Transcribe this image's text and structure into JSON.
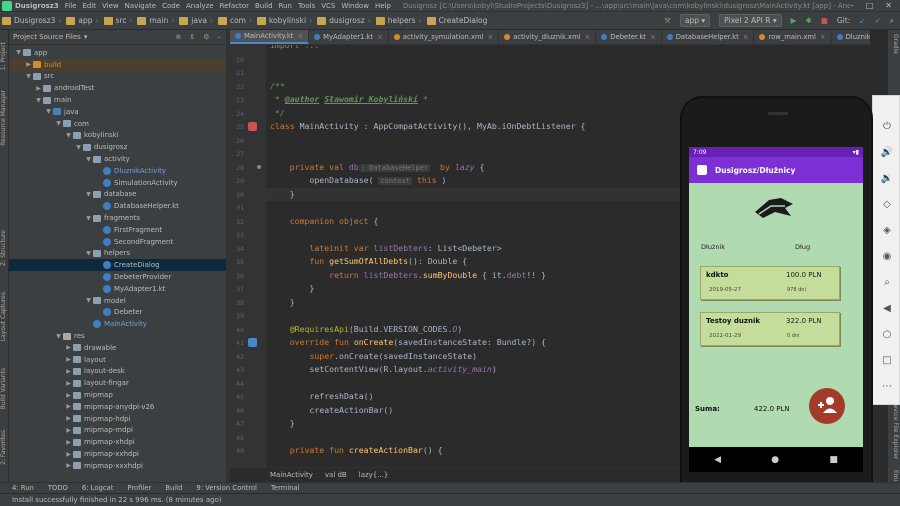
{
  "menubar": {
    "project": "Dusigrosz3",
    "items": [
      "File",
      "Edit",
      "View",
      "Navigate",
      "Code",
      "Analyze",
      "Refactor",
      "Build",
      "Run",
      "Tools",
      "VCS",
      "Window",
      "Help"
    ],
    "title": "Dusigrosz [C:\\Users\\kobyl\\StudioProjects\\Dusigrosz3] - ...\\app\\src\\main\\java\\com\\kobylinski\\dusigrosz\\MainActivity.kt [app] - Android Studio"
  },
  "navbar": {
    "crumbs": [
      "Dusigrosz3",
      "app",
      "src",
      "main",
      "java",
      "com",
      "kobylinski",
      "dusigrosz",
      "helpers",
      "CreateDialog"
    ],
    "run_config": "app",
    "device": "Pixel 2 API R",
    "git": "Git:"
  },
  "sidebar": {
    "left_labels": [
      "1: Project",
      "Resource Manager",
      "Z: Structure",
      "Layout Captures",
      "Build Variants",
      "2: Favorites"
    ],
    "right_labels": [
      "Gradle",
      "Device File Explorer",
      "Emulator"
    ]
  },
  "project": {
    "title": "Project Source Files",
    "tree": [
      {
        "label": "app",
        "depth": 0,
        "icon": "folder",
        "tw": "▼"
      },
      {
        "label": "build",
        "depth": 1,
        "icon": "orange",
        "tw": "▶",
        "style": "orange",
        "hl": true
      },
      {
        "label": "src",
        "depth": 1,
        "icon": "folder",
        "tw": "▼"
      },
      {
        "label": "androidTest",
        "depth": 2,
        "icon": "folder",
        "tw": "▶"
      },
      {
        "label": "main",
        "depth": 2,
        "icon": "folder",
        "tw": "▼"
      },
      {
        "label": "java",
        "depth": 3,
        "icon": "src",
        "tw": "▼"
      },
      {
        "label": "com",
        "depth": 4,
        "icon": "folder",
        "tw": "▼"
      },
      {
        "label": "kobylinski",
        "depth": 5,
        "icon": "folder",
        "tw": "▼"
      },
      {
        "label": "dusigrosz",
        "depth": 6,
        "icon": "folder",
        "tw": "▼"
      },
      {
        "label": "activity",
        "depth": 7,
        "icon": "folder",
        "tw": "▼"
      },
      {
        "label": "DluznikActivity",
        "depth": 8,
        "icon": "kt",
        "style": "blue"
      },
      {
        "label": "SimulationActivity",
        "depth": 8,
        "icon": "kt"
      },
      {
        "label": "database",
        "depth": 7,
        "icon": "folder",
        "tw": "▼"
      },
      {
        "label": "DatabaseHelper.kt",
        "depth": 8,
        "icon": "kt"
      },
      {
        "label": "fragments",
        "depth": 7,
        "icon": "folder",
        "tw": "▼"
      },
      {
        "label": "FirstFragment",
        "depth": 8,
        "icon": "kt"
      },
      {
        "label": "SecondFragment",
        "depth": 8,
        "icon": "kt"
      },
      {
        "label": "helpers",
        "depth": 7,
        "icon": "folder",
        "tw": "▼"
      },
      {
        "label": "CreateDialog",
        "depth": 8,
        "icon": "kt",
        "sel": true
      },
      {
        "label": "DebeterProvider",
        "depth": 8,
        "icon": "kt"
      },
      {
        "label": "MyAdapter1.kt",
        "depth": 8,
        "icon": "kt"
      },
      {
        "label": "model",
        "depth": 7,
        "icon": "folder",
        "tw": "▼"
      },
      {
        "label": "Debeter",
        "depth": 8,
        "icon": "kt"
      },
      {
        "label": "MainActivity",
        "depth": 7,
        "icon": "kt",
        "style": "blue"
      },
      {
        "label": "res",
        "depth": 4,
        "icon": "res",
        "tw": "▼"
      },
      {
        "label": "drawable",
        "depth": 5,
        "icon": "folder",
        "tw": "▶"
      },
      {
        "label": "layout",
        "depth": 5,
        "icon": "folder",
        "tw": "▶"
      },
      {
        "label": "layout-desk",
        "depth": 5,
        "icon": "folder",
        "tw": "▶"
      },
      {
        "label": "layout-fingar",
        "depth": 5,
        "icon": "folder",
        "tw": "▶"
      },
      {
        "label": "mipmap",
        "depth": 5,
        "icon": "folder",
        "tw": "▶"
      },
      {
        "label": "mipmap-anydpi-v26",
        "depth": 5,
        "icon": "folder",
        "tw": "▶"
      },
      {
        "label": "mipmap-hdpi",
        "depth": 5,
        "icon": "folder",
        "tw": "▶"
      },
      {
        "label": "mipmap-mdpi",
        "depth": 5,
        "icon": "folder",
        "tw": "▶"
      },
      {
        "label": "mipmap-xhdpi",
        "depth": 5,
        "icon": "folder",
        "tw": "▶"
      },
      {
        "label": "mipmap-xxhdpi",
        "depth": 5,
        "icon": "folder",
        "tw": "▶"
      },
      {
        "label": "mipmap-xxxhdpi",
        "depth": 5,
        "icon": "folder",
        "tw": "▶"
      }
    ]
  },
  "tabs": [
    "MainActivity.kt",
    "MyAdapter1.kt",
    "activity_symulation.xml",
    "activity_dluznik.xml",
    "Debeter.kt",
    "DatabaseHelper.kt",
    "row_main.xml",
    "DluznikActivity.kt"
  ],
  "editor": {
    "lines": [
      {
        "n": "",
        "t": [
          [
            "k",
            "import ..."
          ]
        ]
      },
      {
        "n": "20",
        "t": []
      },
      {
        "n": "21",
        "t": []
      },
      {
        "n": "22",
        "t": [
          [
            "c",
            "/**"
          ]
        ]
      },
      {
        "n": "23",
        "t": [
          [
            "c",
            " * "
          ],
          [
            "ct",
            "@author"
          ],
          [
            "c",
            " "
          ],
          [
            "ct",
            "Sławomir Kobyliński"
          ],
          [
            "c",
            " *"
          ]
        ]
      },
      {
        "n": "24",
        "t": [
          [
            "c",
            " */"
          ]
        ]
      },
      {
        "n": "25",
        "t": [
          [
            "k",
            "class "
          ],
          [
            "",
            "MainActivity : AppCompatActivity(), MyAb.iOnDebtListener {"
          ]
        ]
      },
      {
        "n": "26",
        "t": []
      },
      {
        "n": "27",
        "t": []
      },
      {
        "n": "28",
        "t": [
          [
            "",
            "    "
          ],
          [
            "k",
            "private val "
          ],
          [
            "p",
            "db"
          ],
          [
            "hint",
            ": DatabaseHelper"
          ],
          [
            "",
            "  "
          ],
          [
            "k",
            "by "
          ],
          [
            "pi",
            "lazy"
          ],
          [
            "",
            " {"
          ]
        ]
      },
      {
        "n": "29",
        "t": [
          [
            "",
            "        openDatabase( "
          ],
          [
            "hint",
            "context"
          ],
          [
            "",
            " "
          ],
          [
            "k",
            "this"
          ],
          [
            "",
            " )"
          ]
        ]
      },
      {
        "n": "30",
        "t": [
          [
            "",
            "    }"
          ]
        ],
        "cur": true
      },
      {
        "n": "31",
        "t": []
      },
      {
        "n": "32",
        "t": [
          [
            "",
            "    "
          ],
          [
            "k",
            "companion object "
          ],
          [
            "",
            "{"
          ]
        ]
      },
      {
        "n": "33",
        "t": []
      },
      {
        "n": "34",
        "t": [
          [
            "",
            "        "
          ],
          [
            "k",
            "lateinit var "
          ],
          [
            "p",
            "listDebters"
          ],
          [
            "",
            ": List<Debeter>"
          ]
        ]
      },
      {
        "n": "35",
        "t": [
          [
            "",
            "        "
          ],
          [
            "k",
            "fun "
          ],
          [
            "fn",
            "getSumOfAllDebts"
          ],
          [
            "",
            "(): Double {"
          ]
        ]
      },
      {
        "n": "36",
        "t": [
          [
            "",
            "            "
          ],
          [
            "k",
            "return "
          ],
          [
            "p",
            "listDebters"
          ],
          [
            ".",
            ""
          ],
          [
            "fn",
            "sumByDouble"
          ],
          [
            "",
            " { it."
          ],
          [
            "p",
            "debt"
          ],
          [
            "",
            "!! }"
          ]
        ]
      },
      {
        "n": "37",
        "t": [
          [
            "",
            "        }"
          ]
        ]
      },
      {
        "n": "38",
        "t": [
          [
            "",
            "    }"
          ]
        ]
      },
      {
        "n": "39",
        "t": []
      },
      {
        "n": "40",
        "t": [
          [
            "an",
            "    @RequiresApi"
          ],
          [
            "",
            "(Build.VERSION_CODES."
          ],
          [
            "pi",
            "O"
          ],
          [
            "",
            ")"
          ]
        ]
      },
      {
        "n": "41",
        "t": [
          [
            "",
            "    "
          ],
          [
            "k",
            "override fun "
          ],
          [
            "fn",
            "onCreate"
          ],
          [
            "",
            "(savedInstanceState: Bundle?) {"
          ]
        ]
      },
      {
        "n": "42",
        "t": [
          [
            "",
            "        "
          ],
          [
            "k",
            "super"
          ],
          [
            "",
            ".onCreate(savedInstanceState)"
          ]
        ]
      },
      {
        "n": "43",
        "t": [
          [
            "",
            "        setContentView(R.layout."
          ],
          [
            "pi",
            "activity_main"
          ],
          [
            "",
            ")"
          ]
        ]
      },
      {
        "n": "44",
        "t": []
      },
      {
        "n": "45",
        "t": [
          [
            "",
            "        refreshData()"
          ]
        ]
      },
      {
        "n": "46",
        "t": [
          [
            "",
            "        createActionBar()"
          ]
        ]
      },
      {
        "n": "47",
        "t": [
          [
            "",
            "    }"
          ]
        ]
      },
      {
        "n": "48",
        "t": []
      },
      {
        "n": "49",
        "t": [
          [
            "",
            "    "
          ],
          [
            "k",
            "private fun "
          ],
          [
            "fn",
            "createActionBar"
          ],
          [
            "",
            "() {"
          ]
        ]
      }
    ],
    "crumbs": [
      "MainActivity",
      "val dB",
      "lazy{...}"
    ]
  },
  "bottom": {
    "tools": [
      "4: Run",
      "TODO",
      "6: Logcat",
      "Profiler",
      "Build",
      "9: Version Control",
      "Terminal"
    ],
    "status": "Install successfully finished in 22 s 996 ms. (8 minutes ago)"
  },
  "phone": {
    "time": "7:09",
    "title": "Dusigrosz/Dłużnicy",
    "col_name": "Dłużnik",
    "col_debt": "Dług",
    "cards": [
      {
        "name": "kdkto",
        "amount": "100.0 PLN",
        "date": "2019-05-27",
        "days": "978 dni"
      },
      {
        "name": "Testoy duznik",
        "amount": "322.0 PLN",
        "date": "2022-01-29",
        "days": "0 dni"
      }
    ],
    "sum_label": "Suma:",
    "sum_value": "422.0 PLN",
    "fab_icon": "add-user-icon"
  }
}
